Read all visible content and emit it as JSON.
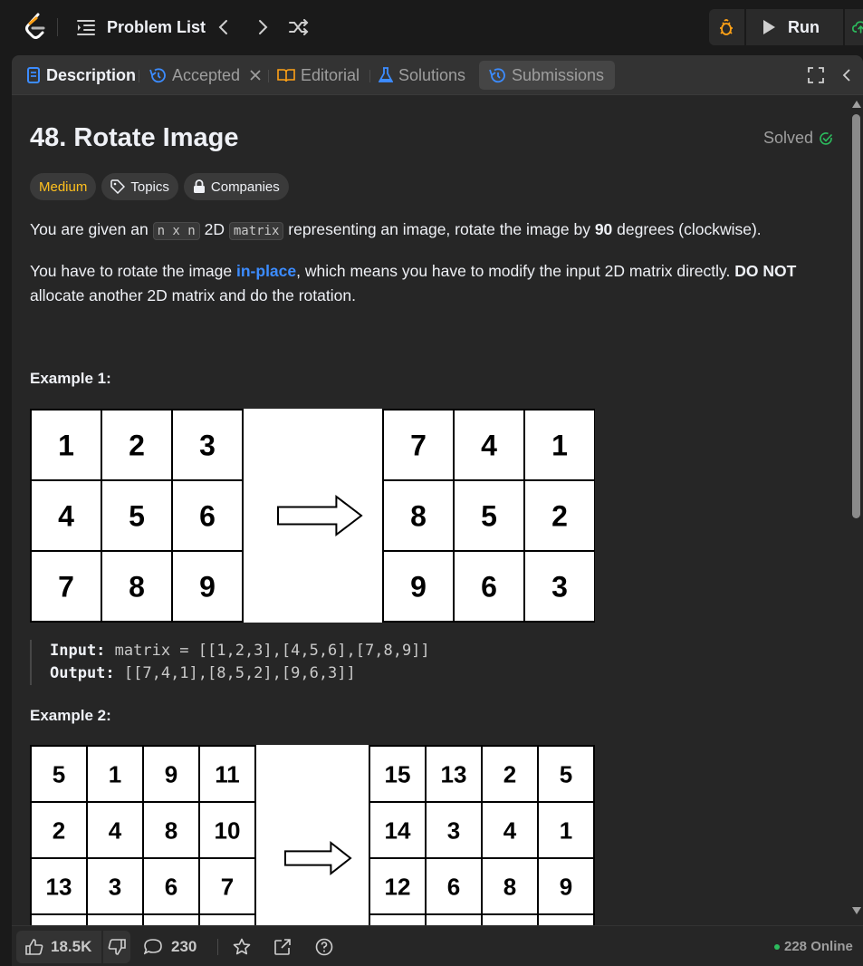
{
  "topbar": {
    "problem_list": "Problem List",
    "run": "Run"
  },
  "tabs": {
    "description": "Description",
    "accepted": "Accepted",
    "editorial": "Editorial",
    "solutions": "Solutions",
    "submissions": "Submissions"
  },
  "problem": {
    "title": "48. Rotate Image",
    "status": "Solved",
    "difficulty": "Medium",
    "topics": "Topics",
    "companies": "Companies",
    "p1_a": "You are given an ",
    "p1_code1": "n x n",
    "p1_b": " 2D ",
    "p1_code2": "matrix",
    "p1_c": " representing an image, rotate the image by ",
    "p1_bold": "90",
    "p1_d": " degrees (clockwise).",
    "p2_a": "You have to rotate the image ",
    "p2_link": "in-place",
    "p2_b": ", which means you have to modify the input 2D matrix directly. ",
    "p2_bold": "DO NOT",
    "p2_c": " allocate another 2D matrix and do the rotation."
  },
  "example1": {
    "title": "Example 1:",
    "input_matrix": [
      [
        1,
        2,
        3
      ],
      [
        4,
        5,
        6
      ],
      [
        7,
        8,
        9
      ]
    ],
    "output_matrix": [
      [
        7,
        4,
        1
      ],
      [
        8,
        5,
        2
      ],
      [
        9,
        6,
        3
      ]
    ],
    "input_label": "Input:",
    "input_value": " matrix = [[1,2,3],[4,5,6],[7,8,9]]",
    "output_label": "Output:",
    "output_value": " [[7,4,1],[8,5,2],[9,6,3]]"
  },
  "example2": {
    "title": "Example 2:",
    "input_matrix_visible": [
      [
        5,
        1,
        9,
        11
      ],
      [
        2,
        4,
        8,
        10
      ],
      [
        13,
        3,
        6,
        7
      ]
    ],
    "output_matrix_visible": [
      [
        15,
        13,
        2,
        5
      ],
      [
        14,
        3,
        4,
        1
      ],
      [
        12,
        6,
        8,
        9
      ]
    ]
  },
  "footer": {
    "likes": "18.5K",
    "comments": "230",
    "online": "228 Online"
  },
  "colors": {
    "accent_blue": "#3c8cff",
    "medium": "#ffc01e",
    "solved_green": "#2cbb5d",
    "run_green": "#2cbb5d"
  }
}
